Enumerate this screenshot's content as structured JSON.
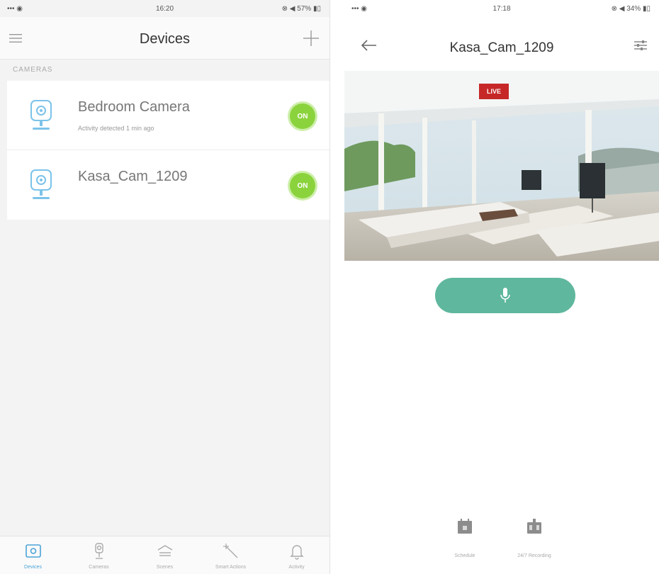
{
  "devices_screen": {
    "status": {
      "left": "••• ◉",
      "time": "16:20",
      "right": "⊗ ◀ 57% ▮▯"
    },
    "title": "Devices",
    "menu_icon": "hamburger-icon",
    "add_icon": "plus-icon",
    "section_label": "CAMERAS",
    "devices": [
      {
        "name": "Bedroom Camera",
        "subtitle": "Activity detected 1 min ago",
        "toggle_label": "ON",
        "icon": "camera-icon"
      },
      {
        "name": "Kasa_Cam_1209",
        "subtitle": "",
        "toggle_label": "ON",
        "icon": "camera-icon"
      }
    ],
    "tabs": [
      {
        "label": "Devices",
        "icon": "devices-icon",
        "active": true
      },
      {
        "label": "Cameras",
        "icon": "camera-icon",
        "active": false
      },
      {
        "label": "Scenes",
        "icon": "scenes-icon",
        "active": false
      },
      {
        "label": "Smart Actions",
        "icon": "smart-actions-icon",
        "active": false
      },
      {
        "label": "Activity",
        "icon": "bell-icon",
        "active": false
      }
    ]
  },
  "camera_screen": {
    "status": {
      "left": "••• ◉",
      "time": "17:18",
      "right": "⊗ ◀ 34% ▮▯"
    },
    "title": "Kasa_Cam_1209",
    "back_icon": "back-arrow-icon",
    "settings_icon": "sliders-icon",
    "live_badge": "LIVE",
    "talk_icon": "microphone-icon",
    "actions": [
      {
        "label": "Schedule",
        "icon": "calendar-icon"
      },
      {
        "label": "24/7 Recording",
        "icon": "recording-icon"
      }
    ]
  },
  "colors": {
    "toggle_on": "#8bd33d",
    "talk_button": "#5fb79d",
    "live_badge": "#c62828",
    "active_tab": "#4aa3d8"
  }
}
